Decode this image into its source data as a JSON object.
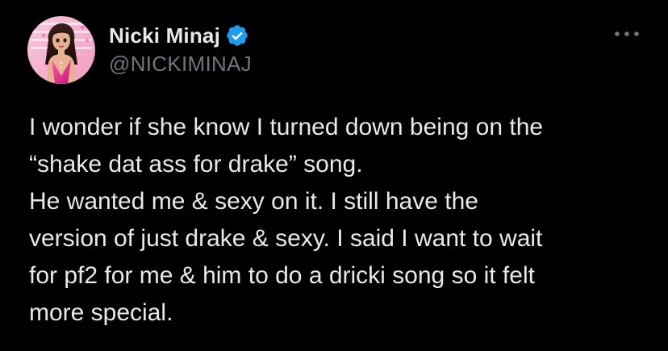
{
  "tweet": {
    "author": {
      "display_name": "Nicki Minaj",
      "handle": "@NICKIMINAJ",
      "verified": true,
      "verified_badge_color": "#1d9bf0",
      "avatar_icon": "profile-avatar"
    },
    "more_icon": "more-dots-icon",
    "text_lines": [
      "I wonder if she know I turned down being on the",
      "“shake dat ass for drake” song.",
      "He wanted me & sexy on it. I still have the",
      "version of just drake & sexy. I said I want to wait",
      "for pf2 for me & him to do a dricki song so it felt",
      "more special."
    ]
  },
  "colors": {
    "background": "#000000",
    "primary_text": "#e7e9ea",
    "secondary_text": "#71767b",
    "accent": "#1d9bf0"
  }
}
